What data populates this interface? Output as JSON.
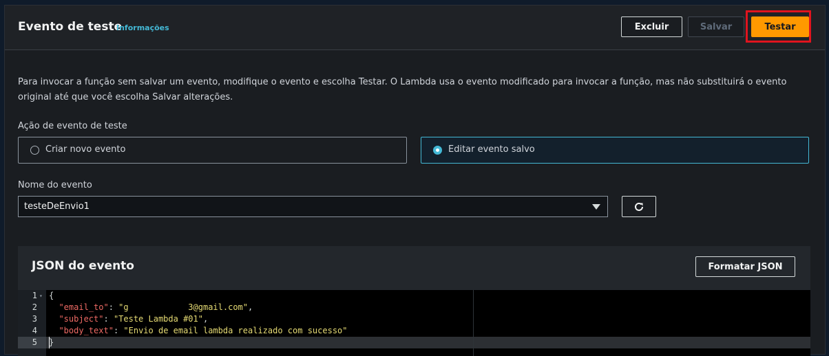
{
  "header": {
    "title": "Evento de teste",
    "info_link": "Informações",
    "buttons": {
      "delete": "Excluir",
      "save": "Salvar",
      "test": "Testar"
    }
  },
  "description": "Para invocar a função sem salvar um evento, modifique o evento e escolha Testar. O Lambda usa o evento modificado para invocar a função, mas não substituirá o evento original até que você escolha Salvar alterações.",
  "action": {
    "label": "Ação de evento de teste",
    "options": [
      {
        "label": "Criar novo evento",
        "selected": false
      },
      {
        "label": "Editar evento salvo",
        "selected": true
      }
    ]
  },
  "event_name": {
    "label": "Nome do evento",
    "value": "testeDeEnvio1"
  },
  "json_section": {
    "title": "JSON do evento",
    "format_button": "Formatar JSON",
    "line_numbers": [
      "1",
      "2",
      "3",
      "4",
      "5"
    ],
    "lines": {
      "l1": "{",
      "l2_key": "\"email_to\"",
      "l2_value": "\"g            3@gmail.com\"",
      "l3_key": "\"subject\"",
      "l3_value": "\"Teste Lambda #01\"",
      "l4_key": "\"body_text\"",
      "l4_value": "\"Envio de email lambda realizado com sucesso\"",
      "l5": "}"
    }
  },
  "colors": {
    "accent": "#ff9900",
    "link": "#44b9d6",
    "highlight_box": "#e0141e"
  }
}
